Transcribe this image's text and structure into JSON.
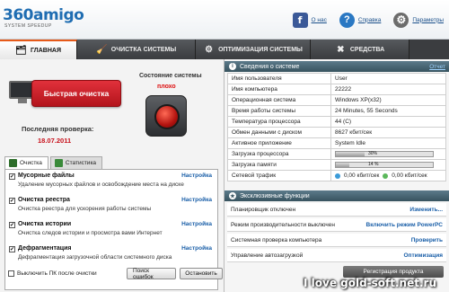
{
  "header": {
    "logo_text": "360amigo",
    "logo_subtitle": "SYSTEM SPEEDUP",
    "links": {
      "about": "О нас",
      "help": "Справка",
      "settings": "Параметры"
    }
  },
  "tabs": [
    {
      "label": "ГЛАВНАЯ",
      "active": true
    },
    {
      "label": "ОЧИСТКА СИСТЕМЫ",
      "active": false
    },
    {
      "label": "ОПТИМИЗАЦИЯ СИСТЕМЫ",
      "active": false
    },
    {
      "label": "СРЕДСТВА",
      "active": false
    }
  ],
  "left": {
    "quick_clean_label": "Быстрая очистка",
    "last_check_label": "Последняя проверка:",
    "last_check_date": "18.07.2011",
    "system_state_label": "Состояние системы",
    "system_state_value": "плохо",
    "subtabs": [
      {
        "label": "Очистка",
        "active": true
      },
      {
        "label": "Статистика",
        "active": false
      }
    ],
    "options": [
      {
        "title": "Мусорные файлы",
        "desc": "Удаление мусорных файлов и освобождение места на диске",
        "link": "Настройка",
        "checked": true
      },
      {
        "title": "Очистка реестра",
        "desc": "Очистка реестра для ускорения работы системы",
        "link": "Настройка",
        "checked": true
      },
      {
        "title": "Очистка истории",
        "desc": "Очистка следов истории и просмотра вами Интернет",
        "link": "Настройка",
        "checked": true
      },
      {
        "title": "Дефрагментация",
        "desc": "Дефрагментация загрузочной области системного диска",
        "link": "Настройка",
        "checked": true
      }
    ],
    "shutdown_label": "Выключить ПК после очистки",
    "search_button": "Поиск ошибок",
    "stop_button": "Остановить"
  },
  "right": {
    "system_info_title": "Сведения о системе",
    "report_link": "Отчет",
    "system_rows": [
      {
        "key": "Имя пользователя",
        "value": "User"
      },
      {
        "key": "Имя компьютера",
        "value": "22222"
      },
      {
        "key": "Операционная система",
        "value": "Windows XP(x32)"
      },
      {
        "key": "Время работы системы",
        "value": "24 Minutes, 55 Seconds"
      },
      {
        "key": "Температура процессора",
        "value": "44 (C)"
      },
      {
        "key": "Обмен данными с диском",
        "value": "8627 кбит/сек"
      },
      {
        "key": "Активное приложение",
        "value": "System Idle"
      }
    ],
    "cpu_label": "Загрузка процессора",
    "cpu_percent_text": "30%",
    "cpu_percent": 30,
    "mem_label": "Загрузка памяти",
    "mem_percent_text": "14 %",
    "mem_percent": 14,
    "net_label": "Сетевой трафик",
    "net_down": "0,00 кбит/сек",
    "net_up": "0,00 кбит/сек",
    "functions_title": "Эксклюзивные функции",
    "functions": [
      {
        "label": "Планировщик отключен",
        "action": "Изменить..."
      },
      {
        "label": "Режим производительности выключен",
        "action": "Включить режим PowerPC"
      },
      {
        "label": "Системная проверка компьютера",
        "action": "Проверить"
      },
      {
        "label": "Управление автозагрузкой",
        "action": "Оптимизация"
      }
    ],
    "register_button": "Регистрация продукта"
  },
  "watermark": "I love gold-soft.net.ru",
  "colors": {
    "accent_red": "#c8111b",
    "link_blue": "#1a5fa8",
    "tab_dark": "#3b3d40"
  }
}
